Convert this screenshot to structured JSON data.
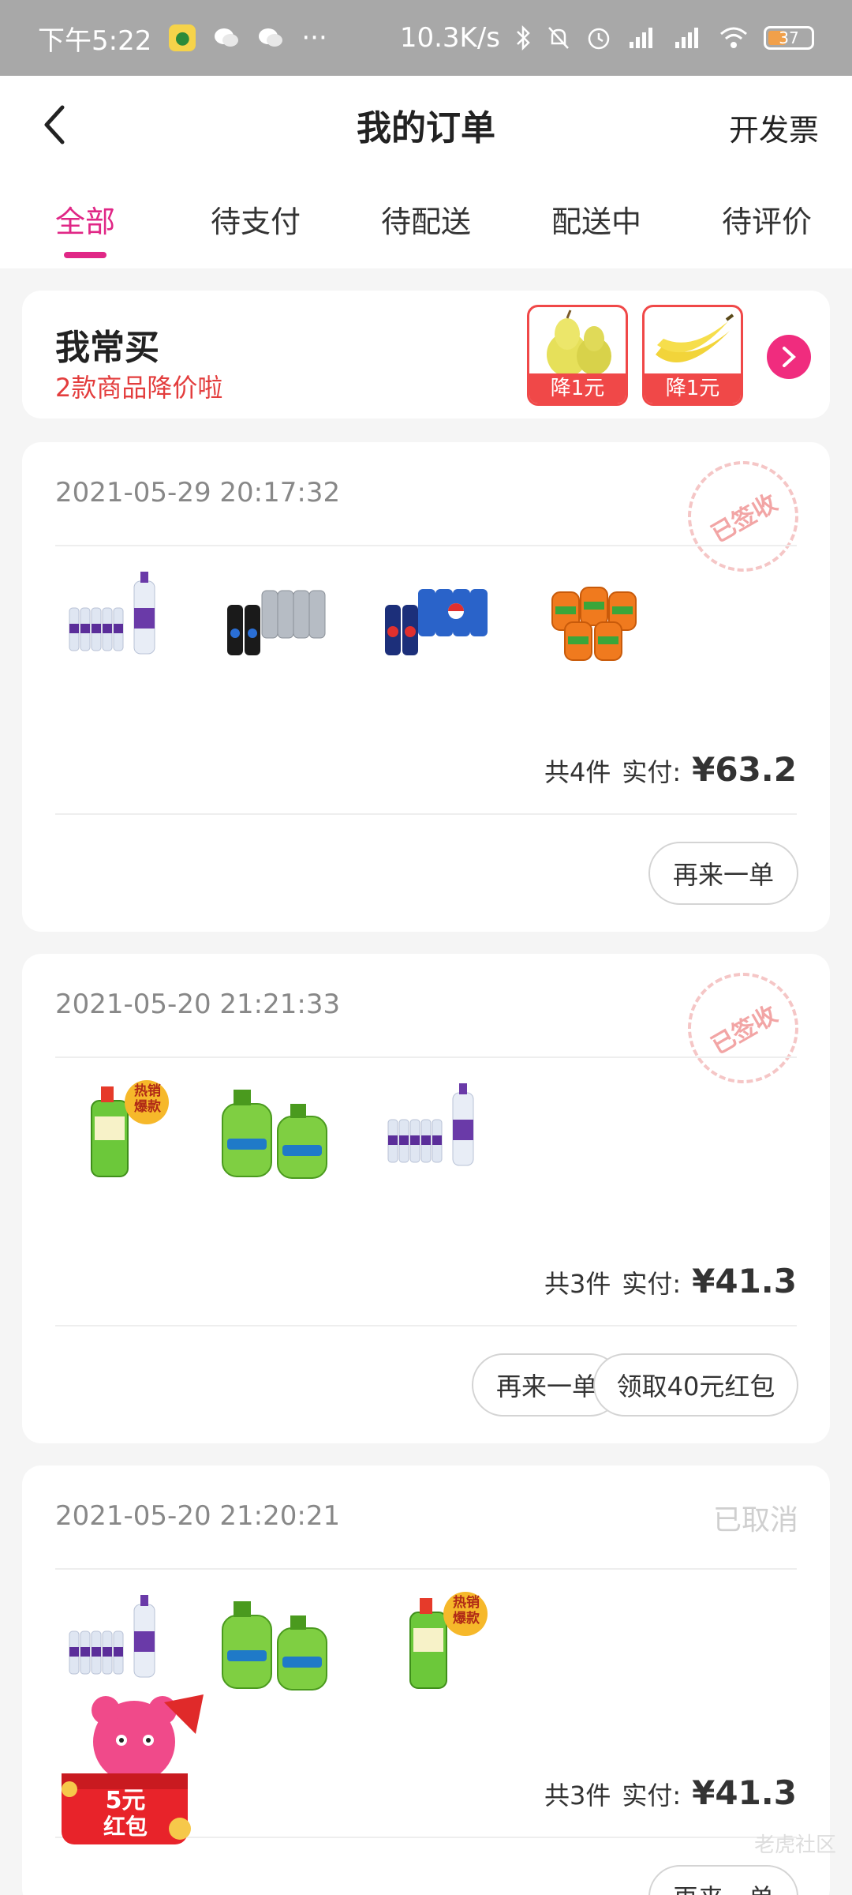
{
  "status_bar": {
    "time": "下午5:22",
    "more": "···",
    "speed": "10.3K/s",
    "battery": "37"
  },
  "header": {
    "title": "我的订单",
    "action": "开发票"
  },
  "tabs": [
    {
      "label": "全部"
    },
    {
      "label": "待支付"
    },
    {
      "label": "待配送"
    },
    {
      "label": "配送中"
    },
    {
      "label": "待评价"
    }
  ],
  "favorites": {
    "title": "我常买",
    "subtitle": "2款商品降价啦",
    "items": [
      {
        "icon": "pear-icon",
        "tag": "降1元"
      },
      {
        "icon": "banana-icon",
        "tag": "降1元"
      }
    ]
  },
  "orders": [
    {
      "date": "2021-05-29 20:17:32",
      "status": "已签收",
      "count": "共4件",
      "paid_label": "实付:",
      "price": "¥63.2",
      "buttons": [
        "再来一单"
      ]
    },
    {
      "date": "2021-05-20 21:21:33",
      "status": "已签收",
      "count": "共3件",
      "paid_label": "实付:",
      "price": "¥41.3",
      "buttons": [
        "再来一单",
        "领取40元红包"
      ],
      "hot_label_1": "热销",
      "hot_label_2": "爆款"
    },
    {
      "date": "2021-05-20 21:20:21",
      "status": "已取消",
      "count": "共3件",
      "paid_label": "实付:",
      "price": "¥41.3",
      "buttons": [
        "再来一单"
      ],
      "hot_label_1": "热销",
      "hot_label_2": "爆款"
    }
  ],
  "floating_promo": {
    "amount": "5元",
    "label": "红包"
  },
  "watermark": "老虎社区",
  "colors": {
    "accent": "#e02786",
    "red": "#f04848"
  }
}
